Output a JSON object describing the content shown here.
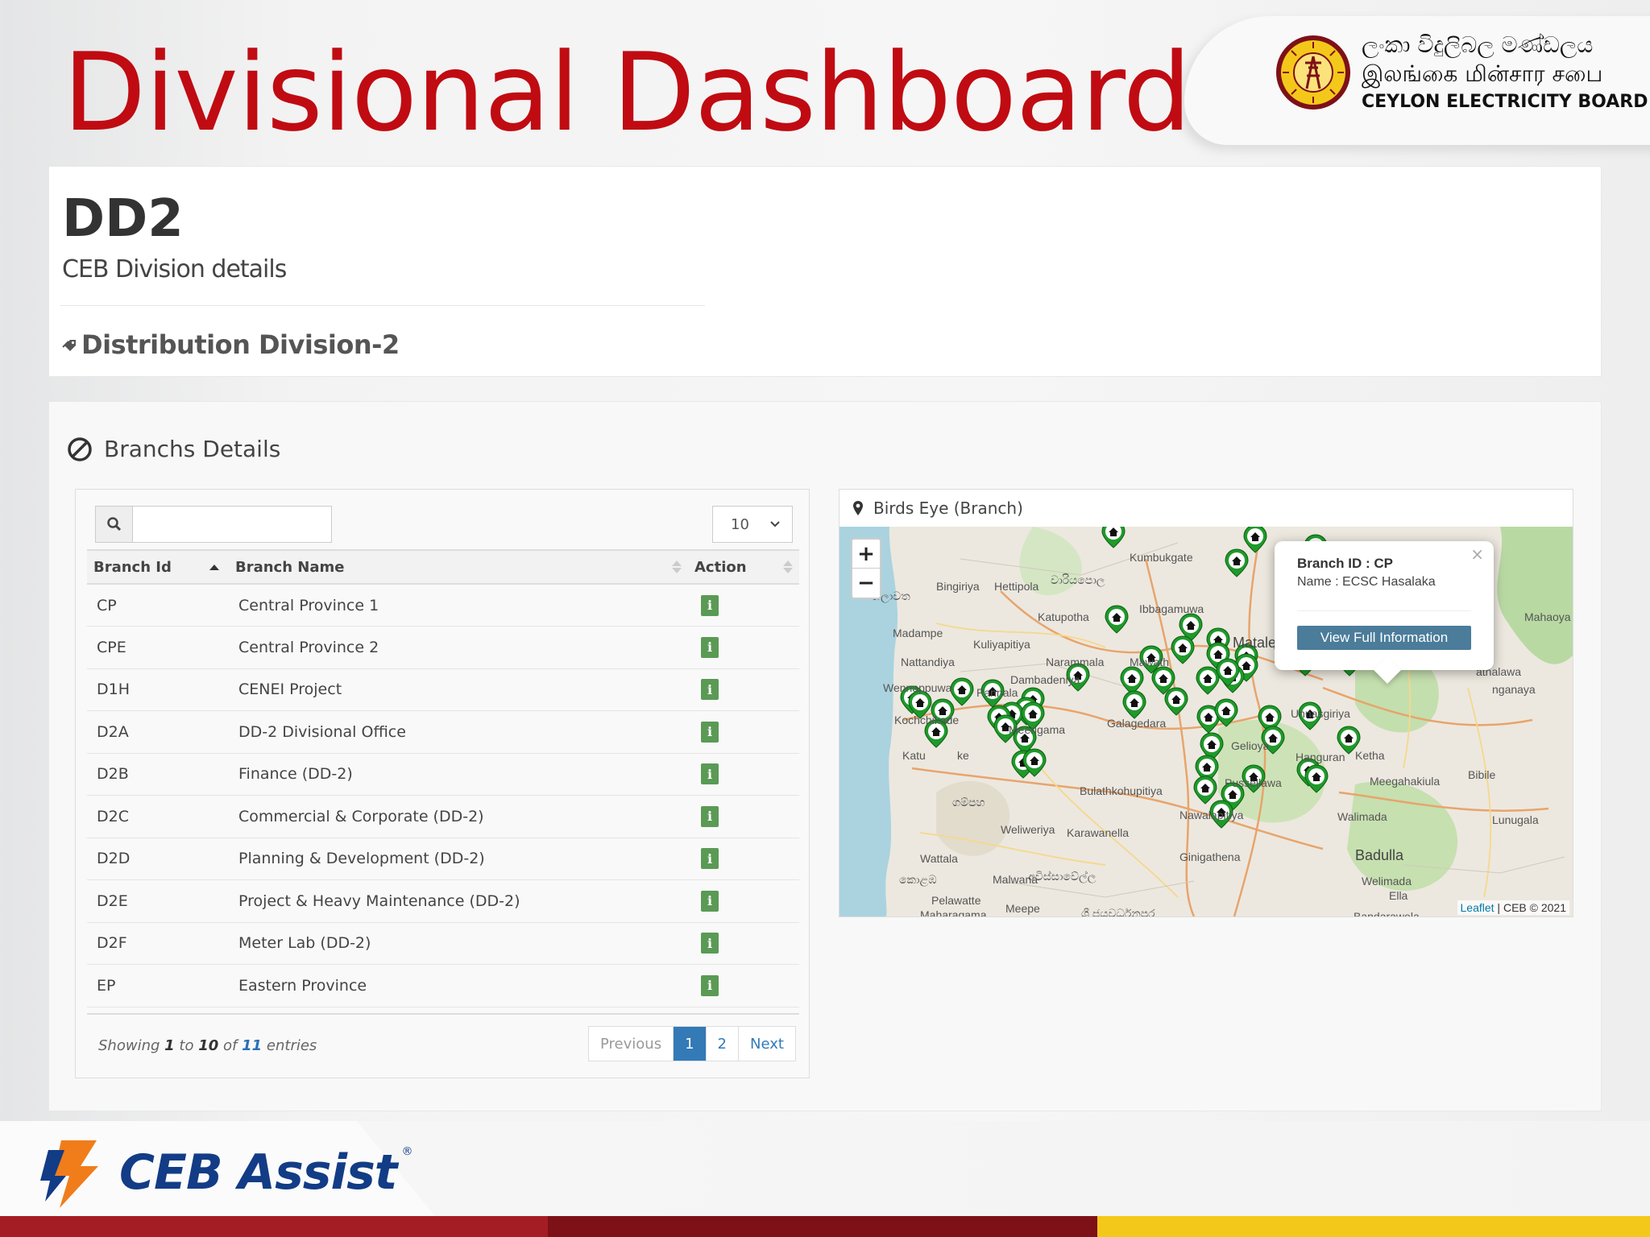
{
  "header": {
    "title": "Divisional Dashboard",
    "org_sinhala": "ලංකා විදුලිබල මණ්ඩලය",
    "org_tamil": "இலங்கை மின்சார சபை",
    "org_english": "CEYLON ELECTRICITY BOARD"
  },
  "division": {
    "id": "DD2",
    "subtitle": "CEB Division details",
    "name": "Distribution Division-2"
  },
  "branches": {
    "section_title": "Branchs Details",
    "search": {
      "value": "",
      "placeholder": ""
    },
    "page_length": "10",
    "columns": [
      "Branch Id",
      "Branch Name",
      "Action"
    ],
    "rows": [
      {
        "id": "CP",
        "name": "Central Province 1"
      },
      {
        "id": "CPE",
        "name": "Central Province 2"
      },
      {
        "id": "D1H",
        "name": "CENEI Project"
      },
      {
        "id": "D2A",
        "name": "DD-2 Divisional Office"
      },
      {
        "id": "D2B",
        "name": "Finance (DD-2)"
      },
      {
        "id": "D2C",
        "name": "Commercial & Corporate (DD-2)"
      },
      {
        "id": "D2D",
        "name": "Planning & Development (DD-2)"
      },
      {
        "id": "D2E",
        "name": "Project & Heavy Maintenance (DD-2)"
      },
      {
        "id": "D2F",
        "name": "Meter Lab (DD-2)"
      },
      {
        "id": "EP",
        "name": "Eastern Province"
      }
    ],
    "info": {
      "prefix": "Showing",
      "from": "1",
      "to_word": "to",
      "to": "10",
      "of_word": "of",
      "total": "11",
      "suffix": "entries"
    },
    "pager": {
      "previous": "Previous",
      "pages": [
        "1",
        "2"
      ],
      "active": "1",
      "next": "Next"
    }
  },
  "map": {
    "title": "Birds Eye (Branch)",
    "zoom_in": "+",
    "zoom_out": "−",
    "popup": {
      "close": "×",
      "branch_line": "Branch ID : CP",
      "name_line": "Name : ECSC Hasalaka",
      "button": "View Full Information"
    },
    "attribution_link": "Leaflet",
    "attribution_text": " | CEB © 2021",
    "marker_color": "#1f9a2a",
    "places": [
      "Kumbukgate",
      "Bingiriya",
      "Hettipola",
      "වාරියපොල",
      "හලාවත",
      "Ibbagamuwa",
      "Katupotha",
      "Madampe",
      "Kuliyapitiya",
      "Matale",
      "Mahaoya",
      "Nattandiya",
      "Narammala",
      "Mawath",
      "Wennappuwa",
      "Pannala",
      "Dambadeniya",
      "athalawa",
      "nganaya",
      "Kochchikade",
      "Meerigama",
      "Galagedara",
      "Gelioya",
      "Katu",
      "ke",
      "Bulathkohupitiya",
      "Hanguran",
      "Ketha",
      "Meegahakiula",
      "Bibile",
      "ගම්පහ",
      "Weliweriya",
      "Karawanella",
      "Pussellawa",
      "Lunugala",
      "Wattala",
      "Ginigathena",
      "Badulla",
      "කොළඹ",
      "Malwana",
      "අවිස්සාවේල්ල",
      "Welimada",
      "Pelawatte",
      "Maharagama",
      "Meepe",
      "Bandarawela",
      "ශ්‍රී ජයවර්ධනපුර",
      "Ella",
      "Nawalapitiya",
      "Walimada",
      "Unnasgiriya"
    ]
  },
  "footer": {
    "product_name": "CEB Assist",
    "registered": "®",
    "stripe_colors": [
      "#a51d24",
      "#7d1117",
      "#f4c81a"
    ]
  }
}
